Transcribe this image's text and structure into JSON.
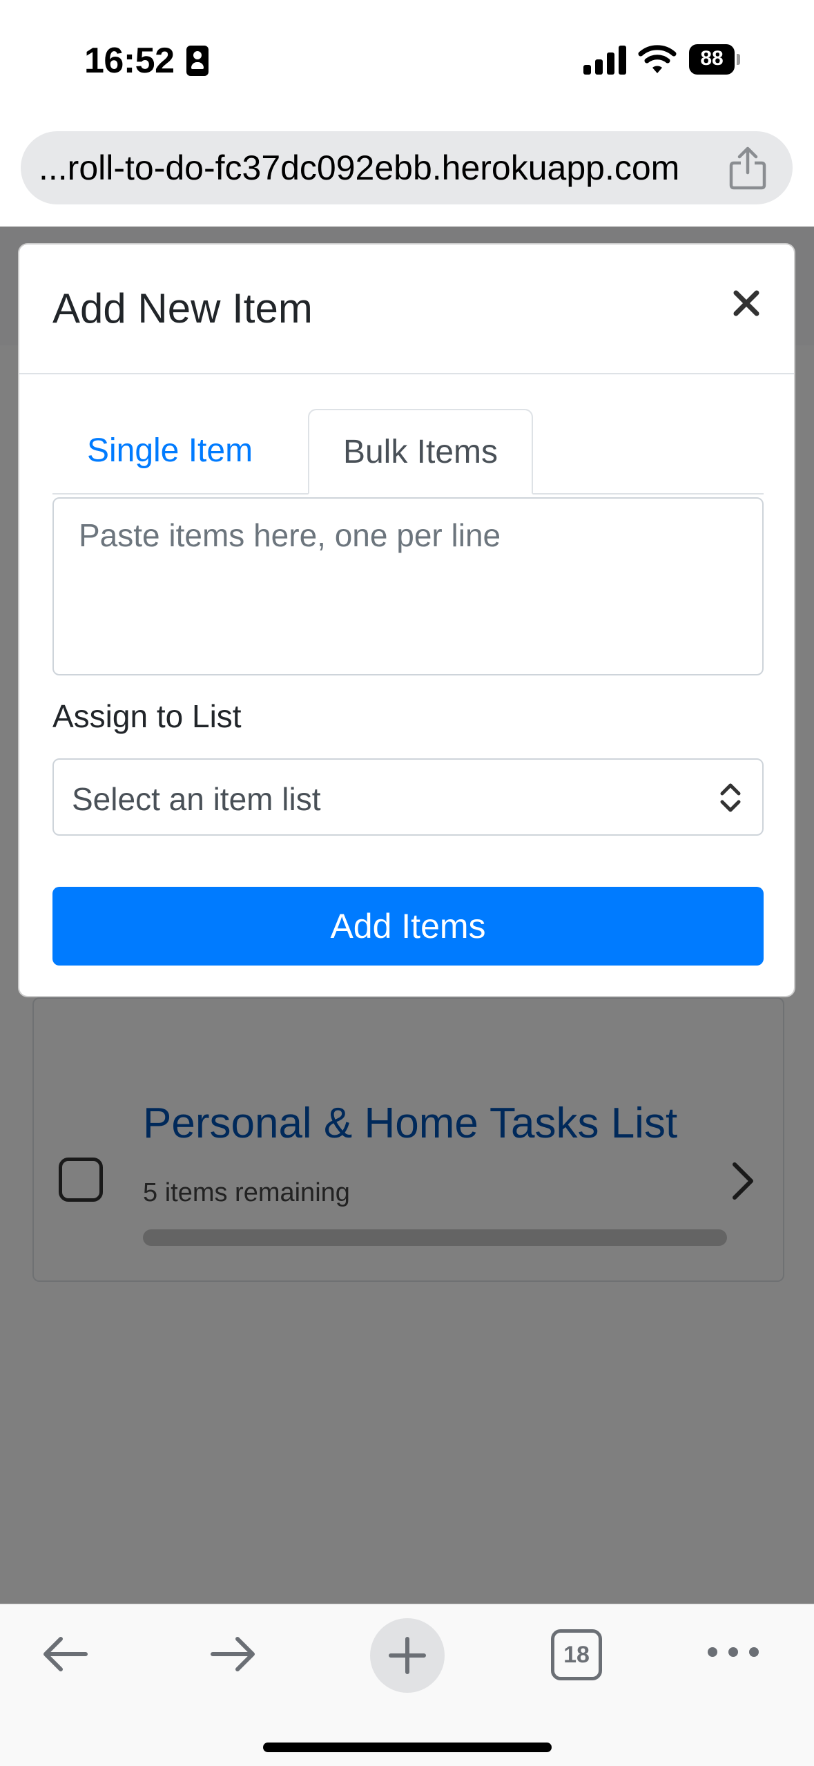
{
  "status_bar": {
    "time": "16:52",
    "battery": "88"
  },
  "browser": {
    "url": "...roll-to-do-fc37dc092ebb.herokuapp.com",
    "tab_count": "18"
  },
  "background_page": {
    "list_card": {
      "title": "Personal & Home Tasks List",
      "subtitle": "5 items remaining"
    }
  },
  "modal": {
    "title": "Add New Item",
    "close_symbol": "×",
    "tabs": [
      {
        "label": "Single Item",
        "active": false
      },
      {
        "label": "Bulk Items",
        "active": true
      }
    ],
    "bulk_textarea": {
      "placeholder": "Paste items here, one per line",
      "value": ""
    },
    "assign_label": "Assign to List",
    "list_select": {
      "selected": "Select an item list",
      "options": [
        "Select an item list"
      ]
    },
    "submit_label": "Add Items"
  },
  "colors": {
    "primary": "#007bff",
    "link": "#007bff",
    "overlay": "rgba(0,0,0,0.5)",
    "list_title": "#0052b4"
  },
  "icons": {
    "status": [
      "contact-card-icon",
      "signal-icon",
      "wifi-icon",
      "battery-icon"
    ],
    "toolbar": [
      "back-arrow-icon",
      "forward-arrow-icon",
      "plus-icon",
      "tabs-icon",
      "more-icon"
    ],
    "modal": [
      "close-icon",
      "select-arrows-icon"
    ],
    "url_bar": [
      "share-icon"
    ]
  }
}
